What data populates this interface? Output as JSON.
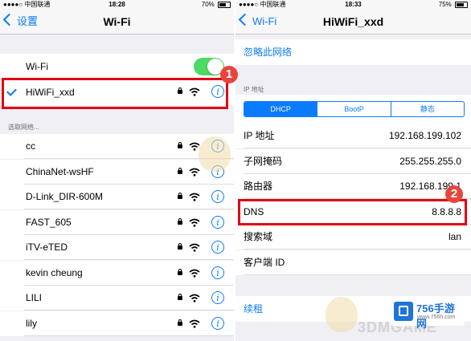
{
  "left": {
    "status": {
      "carrier": "●●●●○ 中国联通",
      "time": "18:28",
      "battery": "70%"
    },
    "nav": {
      "back": "设置",
      "title": "Wi-Fi"
    },
    "wifi_toggle": {
      "label": "Wi-Fi",
      "on": true
    },
    "connected": {
      "name": "HiWiFi_xxd"
    },
    "section_header": "选取网络...",
    "networks": [
      {
        "name": "cc",
        "locked": true
      },
      {
        "name": "ChinaNet-wsHF",
        "locked": true
      },
      {
        "name": "D-Link_DIR-600M",
        "locked": true
      },
      {
        "name": "FAST_605",
        "locked": true
      },
      {
        "name": "iTV-eTED",
        "locked": true
      },
      {
        "name": "kevin cheung",
        "locked": true
      },
      {
        "name": "LILI",
        "locked": true
      },
      {
        "name": "lily",
        "locked": true
      }
    ],
    "badge": "1",
    "info_glyph": "i"
  },
  "right": {
    "status": {
      "carrier": "●●●●○ 中国联通",
      "time": "18:33",
      "battery": "75%"
    },
    "nav": {
      "back": "Wi-Fi",
      "title": "HiWiFi_xxd"
    },
    "forget": "忽略此网络",
    "section_header": "IP 地址",
    "segments": [
      "DHCP",
      "BootP",
      "静态"
    ],
    "fields": [
      {
        "label": "IP 地址",
        "value": "192.168.199.102"
      },
      {
        "label": "子网掩码",
        "value": "255.255.255.0"
      },
      {
        "label": "路由器",
        "value": "192.168.199.1"
      },
      {
        "label": "DNS",
        "value": "8.8.8.8"
      },
      {
        "label": "搜索域",
        "value": "lan"
      },
      {
        "label": "客户端 ID",
        "value": ""
      }
    ],
    "renew": "续租",
    "badge": "2"
  },
  "watermark": {
    "site": "756手游网",
    "site_sub": "www.756h.com",
    "text": "3DMGAME"
  },
  "colors": {
    "accent": "#0a7aff",
    "toggle_on": "#4cd964",
    "highlight": "#e30012",
    "badge": "#e8453c"
  }
}
